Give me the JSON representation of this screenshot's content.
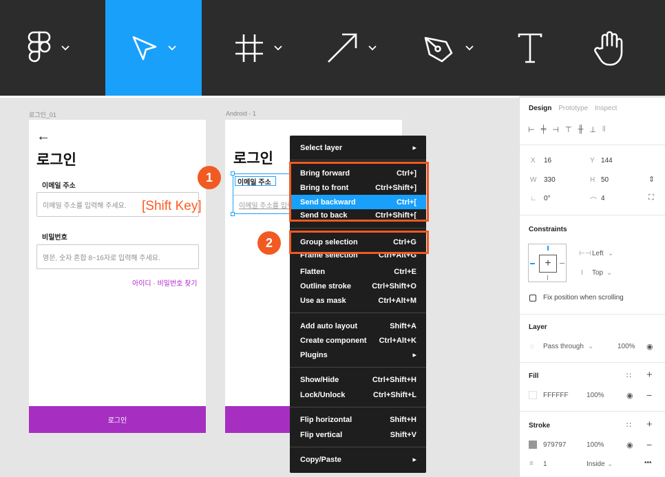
{
  "toolbar": {
    "tools": [
      {
        "name": "figma-menu",
        "icon": "figma-logo-icon"
      },
      {
        "name": "move-tool",
        "icon": "cursor-arrow-icon",
        "active": true
      },
      {
        "name": "frame-tool",
        "icon": "frame-hash-icon"
      },
      {
        "name": "line-tool",
        "icon": "arrow-line-icon"
      },
      {
        "name": "pen-tool",
        "icon": "pen-nib-icon"
      },
      {
        "name": "text-tool",
        "icon": "text-t-icon"
      },
      {
        "name": "hand-tool",
        "icon": "hand-icon"
      }
    ],
    "active_color": "#18a0fb"
  },
  "canvas": {
    "frame1": {
      "label": "로그인_01",
      "back_arrow": "←",
      "title": "로그인",
      "email_label": "이메일 주소",
      "email_placeholder": "이메일 주소를 입력해 주세요.",
      "password_label": "비밀번호",
      "password_placeholder": "영문, 숫자 혼합 8~16자로 입력해 주세요.",
      "find_link": "아이디 · 비밀번호 찾기",
      "login_button": "로그인"
    },
    "frame2": {
      "label": "Android - 1",
      "title": "로그인",
      "email_label": "이메일 주소",
      "email_placeholder": "이메일 주소를 입력"
    },
    "annotation": {
      "shift_key": "[Shift Key]",
      "badge1": "1",
      "badge2": "2",
      "accent": "#f15a22"
    }
  },
  "context_menu": {
    "items": [
      {
        "label": "Select layer",
        "shortcut": "▸"
      },
      {
        "label": "Bring forward",
        "shortcut": "Ctrl+]"
      },
      {
        "label": "Bring to front",
        "shortcut": "Ctrl+Shift+]"
      },
      {
        "label": "Send backward",
        "shortcut": "Ctrl+[",
        "highlighted": true
      },
      {
        "label": "Send to back",
        "shortcut": "Ctrl+Shift+["
      },
      {
        "label": "Group selection",
        "shortcut": "Ctrl+G"
      },
      {
        "label": "Frame selection",
        "shortcut": "Ctrl+Alt+G"
      },
      {
        "label": "Flatten",
        "shortcut": "Ctrl+E"
      },
      {
        "label": "Outline stroke",
        "shortcut": "Ctrl+Shift+O"
      },
      {
        "label": "Use as mask",
        "shortcut": "Ctrl+Alt+M"
      },
      {
        "label": "Add auto layout",
        "shortcut": "Shift+A"
      },
      {
        "label": "Create component",
        "shortcut": "Ctrl+Alt+K"
      },
      {
        "label": "Plugins",
        "shortcut": "▸"
      },
      {
        "label": "Show/Hide",
        "shortcut": "Ctrl+Shift+H"
      },
      {
        "label": "Lock/Unlock",
        "shortcut": "Ctrl+Shift+L"
      },
      {
        "label": "Flip horizontal",
        "shortcut": "Shift+H"
      },
      {
        "label": "Flip vertical",
        "shortcut": "Shift+V"
      },
      {
        "label": "Copy/Paste",
        "shortcut": "▸"
      }
    ]
  },
  "panel": {
    "tabs": [
      "Design",
      "Prototype",
      "Inspect"
    ],
    "x_label": "X",
    "x_value": "16",
    "y_label": "Y",
    "y_value": "144",
    "w_label": "W",
    "w_value": "330",
    "h_label": "H",
    "h_value": "50",
    "rotation": "0°",
    "radius": "4",
    "constraints_title": "Constraints",
    "constraint_h": "Left",
    "constraint_v": "Top",
    "fix_position": "Fix position when scrolling",
    "layer_title": "Layer",
    "blend_mode": "Pass through",
    "layer_opacity": "100%",
    "fill_title": "Fill",
    "fill_hex": "FFFFFF",
    "fill_opacity": "100%",
    "stroke_title": "Stroke",
    "stroke_hex": "979797",
    "stroke_opacity": "100%",
    "stroke_weight": "1",
    "stroke_position": "Inside",
    "more": "•••"
  }
}
